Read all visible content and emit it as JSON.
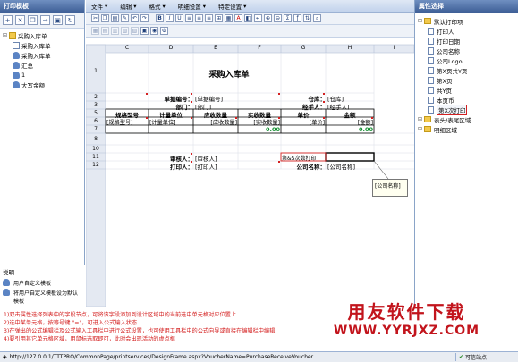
{
  "left_panel": {
    "title": "打印模板",
    "tree": [
      {
        "label": "采购入库单",
        "level": 0,
        "icon": "folder"
      },
      {
        "label": "采购入库单",
        "level": 1,
        "icon": "doc"
      },
      {
        "label": "采购入库单",
        "level": 1,
        "icon": "user"
      },
      {
        "label": "汇总",
        "level": 1,
        "icon": "user"
      },
      {
        "label": "1",
        "level": 1,
        "icon": "user"
      },
      {
        "label": "大写金额",
        "level": 1,
        "icon": "user"
      }
    ],
    "desc_title": "说明",
    "links": [
      "用户自定义模板",
      "将用户自定义模板设为默认模板"
    ]
  },
  "menu": [
    "文件",
    "编辑",
    "格式",
    "明细设置",
    "特定设置"
  ],
  "sheet": {
    "col_headers": [
      "C",
      "D",
      "E",
      "F",
      "G",
      "H",
      "I"
    ],
    "row_headers": [
      "1",
      "2",
      "3",
      "5",
      "6",
      "7",
      "8",
      "10",
      "11",
      "12"
    ],
    "title": "采购入库单",
    "r2_label": "单据编号：",
    "r2_value": "[单据编号]",
    "r2_label2": "仓库：",
    "r2_value2": "[仓库]",
    "r3_label": "部门：",
    "r3_value": "[部门]",
    "r3_label2": "经手人：",
    "r3_value2": "[经手人]",
    "table_headers": [
      "规格型号",
      "计量单位",
      "应收数量",
      "实收数量",
      "单价",
      "金额"
    ],
    "table_fields": [
      "[规格型号]",
      "[计量单位]",
      "[应收数量]",
      "[实收数量]",
      "[单价]",
      "[金额]"
    ],
    "totals": [
      "0.00",
      "0.00"
    ],
    "r11_label": "审核人：",
    "r11_value": "[审核人]",
    "r11_right": "第&S次数打印",
    "r12_label": "打印人：",
    "r12_value": "[打印人]",
    "r12_label2": "公司名称：",
    "r12_value2": "[公司名称]",
    "tooltip": "[公司名称]"
  },
  "right_panel": {
    "title": "属性选择",
    "root": "默认打印项",
    "items": [
      "打印人",
      "打印日期",
      "公司名称",
      "公司Logo",
      "第X页共Y页",
      "第X页",
      "共Y页",
      "本页币",
      "第X次打印"
    ],
    "groups": [
      "表头/表尾区域",
      "明细区域"
    ]
  },
  "hints": [
    "1)双击属性选择列表中的字段节点，可将该字段添加到设计区域中的当前选中单元格对应位置上",
    "2)选中某单元格，按等号键 \"=\"，可进入公式输入状态",
    "3)在弹出的公式编辑栏及公式输入工具栏中进行公式设置，也可使用工具栏中的公式向导或直接在编辑栏中编辑",
    "4)要引用其它单元格区域，用鼠标选取即可，此时会出现活动的虚点框"
  ],
  "watermark": {
    "line1": "用友软件下载",
    "line2": "WWW.YYRJXZ.COM"
  },
  "status": {
    "url": "http://127.0.0.1/TTTPRO/CommonPage/printservices/DesignFrame.aspx?VoucherName=PurchaseReceiveVoucher",
    "zone": "可信站点"
  }
}
